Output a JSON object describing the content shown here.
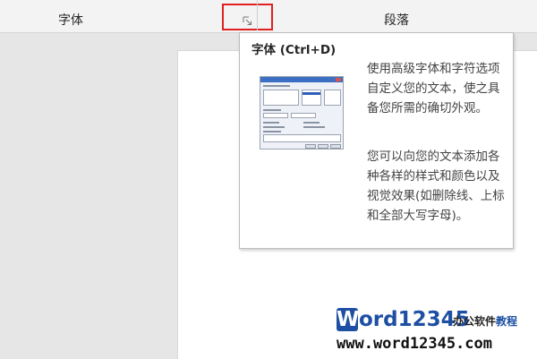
{
  "ribbon": {
    "font_group_label": "字体",
    "paragraph_group_label": "段落",
    "font_dialog_launcher_icon": "dialog-launcher-icon",
    "highlight_color": "#e02020"
  },
  "tooltip": {
    "title": "字体 (Ctrl+D)",
    "paragraph1": "使用高级字体和字符选项自定义您的文本，使之具备您所需的确切外观。",
    "paragraph2": "您可以向您的文本添加各种各样的样式和颜色以及视觉效果(如删除线、上标和全部大写字母)。",
    "preview_image": "font-dialog-thumbnail"
  },
  "watermark": {
    "brand": "ord12345",
    "brand_initial": "W",
    "suffix_part1": "办公软件",
    "suffix_part2": "教程",
    "url": "www.word12345.com"
  }
}
